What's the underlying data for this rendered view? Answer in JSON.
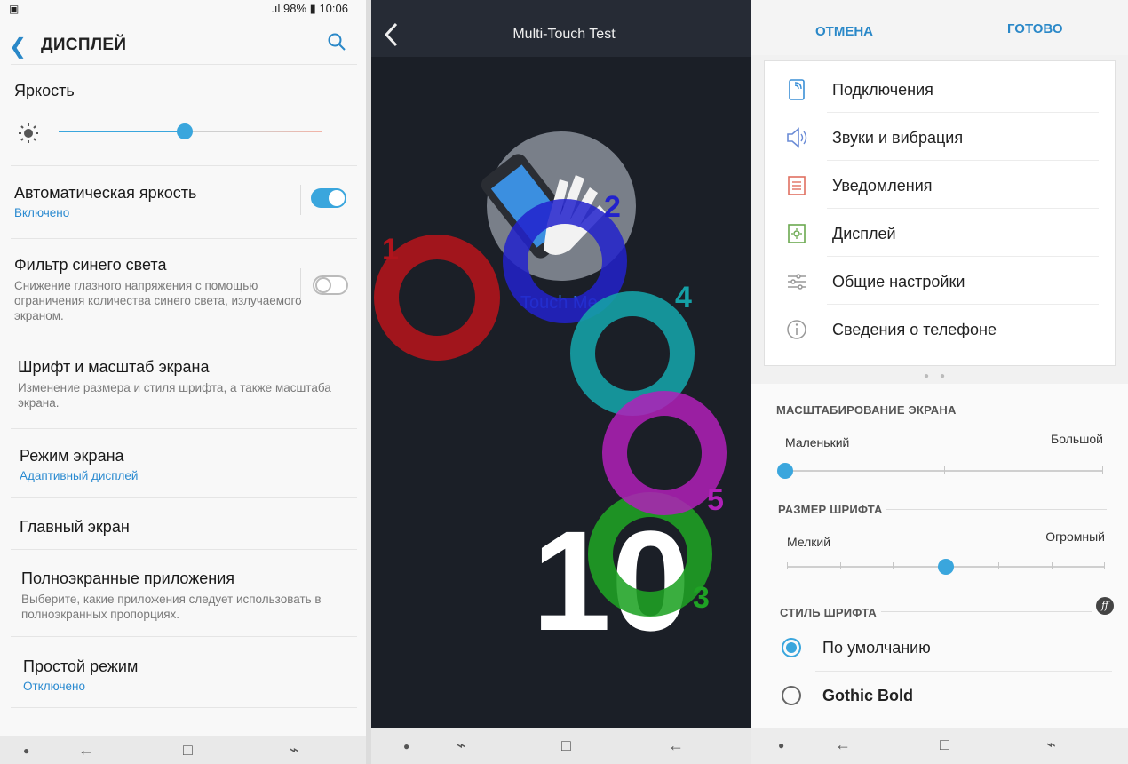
{
  "display_screen": {
    "status": {
      "battery": "98%",
      "time": "10:06"
    },
    "title": "ДИСПЛЕЙ",
    "brightness": {
      "label": "Яркость",
      "level": 0.48
    },
    "auto_brightness": {
      "title": "Автоматическая яркость",
      "status": "Включено",
      "enabled": true
    },
    "blue_filter": {
      "title": "Фильтр синего света",
      "subtitle": "Снижение глазного напряжения с помощью ограничения количества синего света, излучаемого экраном.",
      "enabled": false
    },
    "font_scale": {
      "title": "Шрифт и масштаб экрана",
      "subtitle": "Изменение размера и стиля шрифта, а также масштаба экрана."
    },
    "screen_mode": {
      "title": "Режим экрана",
      "status": "Адаптивный дисплей"
    },
    "home_screen": {
      "title": "Главный экран"
    },
    "fullscreen_apps": {
      "title": "Полноэкранные приложения",
      "subtitle": "Выберите, какие приложения следует использовать в полноэкранных пропорциях."
    },
    "easy_mode": {
      "title": "Простой режим",
      "status": "Отключено"
    }
  },
  "multitouch": {
    "title": "Multi-Touch Test",
    "touch_me": "Touch Me",
    "count": "10",
    "touches": [
      {
        "label": "1",
        "color": "#b0141c"
      },
      {
        "label": "2",
        "color": "#2222cc"
      },
      {
        "label": "3",
        "color": "#1fa324"
      },
      {
        "label": "4",
        "color": "#15a0a6"
      },
      {
        "label": "5",
        "color": "#b020b8"
      }
    ]
  },
  "font_screen": {
    "cancel": "ОТМЕНА",
    "done": "ГОТОВО",
    "menu": [
      {
        "label": "Подключения",
        "icon": "connections-icon"
      },
      {
        "label": "Звуки и вибрация",
        "icon": "speaker-icon"
      },
      {
        "label": "Уведомления",
        "icon": "notifications-icon"
      },
      {
        "label": "Дисплей",
        "icon": "display-icon"
      },
      {
        "label": "Общие настройки",
        "icon": "sliders-icon"
      },
      {
        "label": "Сведения о телефоне",
        "icon": "info-icon"
      }
    ],
    "zoom": {
      "header": "МАСШТАБИРОВАНИЕ ЭКРАНА",
      "min": "Маленький",
      "max": "Большой",
      "value_fraction": 0.0
    },
    "font_size": {
      "header": "РАЗМЕР ШРИФТА",
      "min": "Мелкий",
      "max": "Огромный",
      "value_fraction": 0.5
    },
    "font_style": {
      "header": "СТИЛЬ ШРИФТА",
      "options": [
        "По умолчанию",
        "Gothic Bold"
      ],
      "selected": 0
    }
  },
  "colors": {
    "accent": "#3aa6dd",
    "link": "#2a8ad0"
  }
}
